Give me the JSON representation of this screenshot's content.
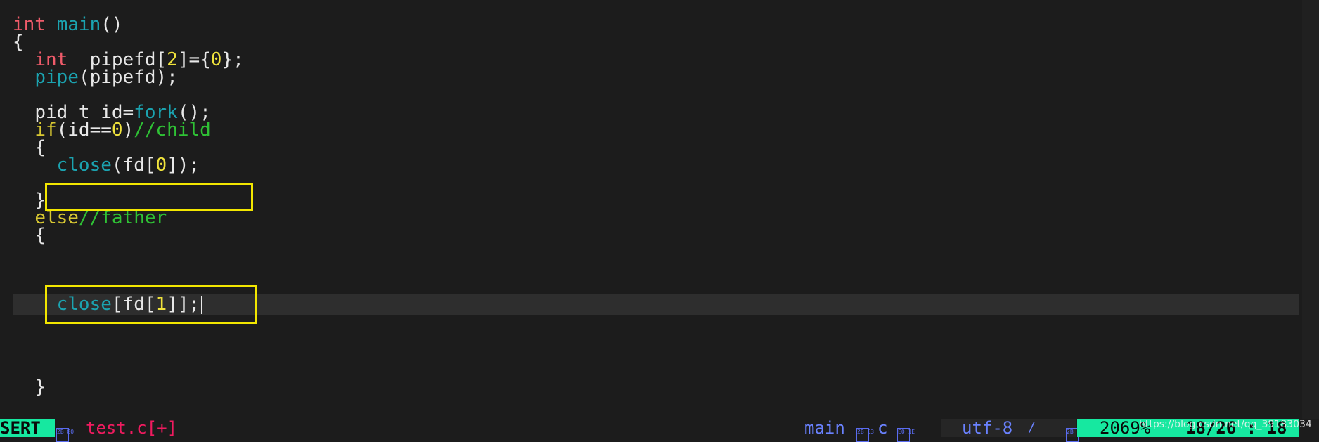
{
  "code": {
    "l1": {
      "type": "int",
      "name": "main",
      "parens": "()"
    },
    "l2": {
      "brace": "{"
    },
    "l3": {
      "type": "int",
      "rest1": "  pipefd[",
      "n1": "2",
      "rest2": "]={",
      "n2": "0",
      "rest3": "};"
    },
    "l4": {
      "fn": "pipe",
      "rest": "(pipefd);"
    },
    "l6": {
      "a": "pid_t id=",
      "fn": "fork",
      "b": "();"
    },
    "l7": {
      "kw": "if",
      "a": "(id==",
      "n": "0",
      "b": ")",
      "cmt": "//child"
    },
    "l8": {
      "brace": "{"
    },
    "l9": {
      "fn": "close",
      "a": "(fd[",
      "n": "0",
      "b": "]);"
    },
    "l11": {
      "brace": "}"
    },
    "l12": {
      "kw": "else",
      "cmt": "//father"
    },
    "l13": {
      "brace": "{"
    },
    "l14": {
      "fn": "close",
      "a": "[fd[",
      "n": "1",
      "b": "]];"
    },
    "l18": {
      "brace": "}"
    }
  },
  "statusline": {
    "mode": "SERT",
    "mode_glyph": "2B 80",
    "filename": "test.c[+]",
    "function": "main",
    "function_glyph": "2B 63",
    "filetype": "c",
    "filetype_glyph": "E0 1E",
    "encoding": "utf-8",
    "fileformat": "/",
    "position_glyph": "2B 81",
    "percent": "2069%",
    "line_col": "18/26 : 18"
  },
  "watermark": "https://blog.csdn.net/qq_39183034",
  "colors": {
    "background": "#1c1c1c",
    "highlight_box": "#f2e600",
    "mode_bg": "#16e8a0",
    "filename": "#ef1b5f"
  }
}
